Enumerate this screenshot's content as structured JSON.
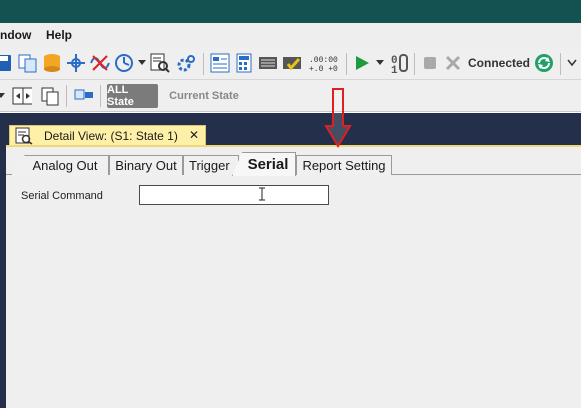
{
  "menubar": {
    "items": [
      {
        "label": "ndow"
      },
      {
        "label": "Help"
      }
    ]
  },
  "toolbar": {
    "connection_status": "Connected",
    "icons": [
      "save-icon",
      "copy-icon",
      "database-icon",
      "network-icon",
      "wave-cross-icon",
      "clock-dial-icon",
      "dropdown-arrow-icon",
      "search-report-icon",
      "settings-gear-icon",
      "settings-grid-icon",
      "calculator-icon",
      "memory-icon",
      "checklist-icon",
      "timer-digits-icon",
      "play-icon",
      "dropdown-arrow-icon",
      "binary-icon",
      "stop-icon",
      "cancel-icon",
      "refresh-icon"
    ]
  },
  "state_toolbar": {
    "all_state_label": "ALL State",
    "current_state_label": "Current State"
  },
  "detail_view": {
    "tab_title": "Detail View: (S1: State 1)",
    "close_label": "✕",
    "tabs": [
      {
        "label": "Analog Out"
      },
      {
        "label": "Binary Out"
      },
      {
        "label": "Trigger"
      },
      {
        "label": "Serial"
      },
      {
        "label": "Report Setting"
      }
    ],
    "active_tab": "Serial",
    "serial_command": {
      "label": "Serial Command",
      "value": ""
    }
  },
  "colors": {
    "title_bar": "#135250",
    "navy_background": "#24304b",
    "doc_tab": "#fff0a8",
    "arrow_red": "#e02020",
    "connected_green": "#22a06b"
  }
}
